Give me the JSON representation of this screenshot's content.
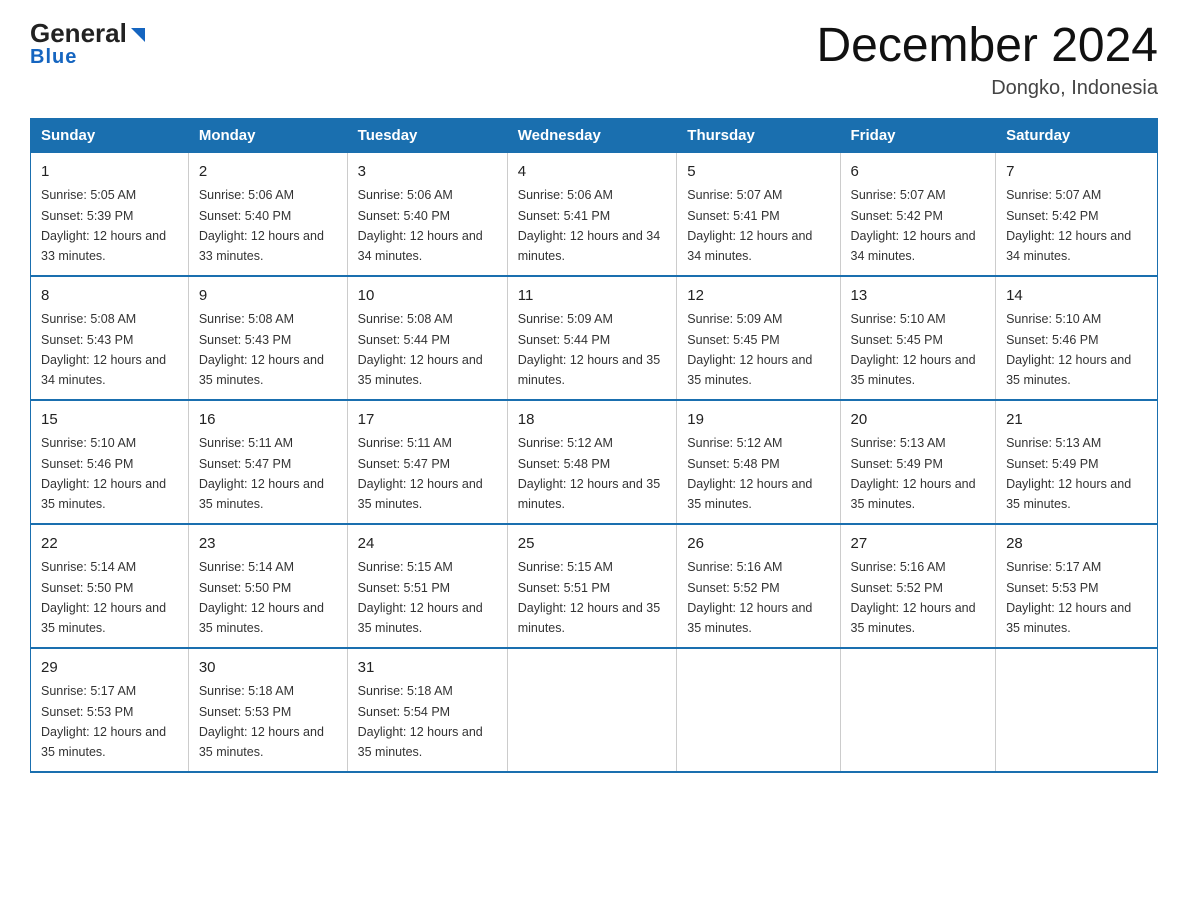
{
  "logo": {
    "general": "General",
    "blue": "Blue",
    "triangle_color": "#1565c0"
  },
  "title": {
    "month_year": "December 2024",
    "location": "Dongko, Indonesia"
  },
  "headers": [
    "Sunday",
    "Monday",
    "Tuesday",
    "Wednesday",
    "Thursday",
    "Friday",
    "Saturday"
  ],
  "weeks": [
    [
      {
        "day": "1",
        "sunrise": "5:05 AM",
        "sunset": "5:39 PM",
        "daylight": "12 hours and 33 minutes."
      },
      {
        "day": "2",
        "sunrise": "5:06 AM",
        "sunset": "5:40 PM",
        "daylight": "12 hours and 33 minutes."
      },
      {
        "day": "3",
        "sunrise": "5:06 AM",
        "sunset": "5:40 PM",
        "daylight": "12 hours and 34 minutes."
      },
      {
        "day": "4",
        "sunrise": "5:06 AM",
        "sunset": "5:41 PM",
        "daylight": "12 hours and 34 minutes."
      },
      {
        "day": "5",
        "sunrise": "5:07 AM",
        "sunset": "5:41 PM",
        "daylight": "12 hours and 34 minutes."
      },
      {
        "day": "6",
        "sunrise": "5:07 AM",
        "sunset": "5:42 PM",
        "daylight": "12 hours and 34 minutes."
      },
      {
        "day": "7",
        "sunrise": "5:07 AM",
        "sunset": "5:42 PM",
        "daylight": "12 hours and 34 minutes."
      }
    ],
    [
      {
        "day": "8",
        "sunrise": "5:08 AM",
        "sunset": "5:43 PM",
        "daylight": "12 hours and 34 minutes."
      },
      {
        "day": "9",
        "sunrise": "5:08 AM",
        "sunset": "5:43 PM",
        "daylight": "12 hours and 35 minutes."
      },
      {
        "day": "10",
        "sunrise": "5:08 AM",
        "sunset": "5:44 PM",
        "daylight": "12 hours and 35 minutes."
      },
      {
        "day": "11",
        "sunrise": "5:09 AM",
        "sunset": "5:44 PM",
        "daylight": "12 hours and 35 minutes."
      },
      {
        "day": "12",
        "sunrise": "5:09 AM",
        "sunset": "5:45 PM",
        "daylight": "12 hours and 35 minutes."
      },
      {
        "day": "13",
        "sunrise": "5:10 AM",
        "sunset": "5:45 PM",
        "daylight": "12 hours and 35 minutes."
      },
      {
        "day": "14",
        "sunrise": "5:10 AM",
        "sunset": "5:46 PM",
        "daylight": "12 hours and 35 minutes."
      }
    ],
    [
      {
        "day": "15",
        "sunrise": "5:10 AM",
        "sunset": "5:46 PM",
        "daylight": "12 hours and 35 minutes."
      },
      {
        "day": "16",
        "sunrise": "5:11 AM",
        "sunset": "5:47 PM",
        "daylight": "12 hours and 35 minutes."
      },
      {
        "day": "17",
        "sunrise": "5:11 AM",
        "sunset": "5:47 PM",
        "daylight": "12 hours and 35 minutes."
      },
      {
        "day": "18",
        "sunrise": "5:12 AM",
        "sunset": "5:48 PM",
        "daylight": "12 hours and 35 minutes."
      },
      {
        "day": "19",
        "sunrise": "5:12 AM",
        "sunset": "5:48 PM",
        "daylight": "12 hours and 35 minutes."
      },
      {
        "day": "20",
        "sunrise": "5:13 AM",
        "sunset": "5:49 PM",
        "daylight": "12 hours and 35 minutes."
      },
      {
        "day": "21",
        "sunrise": "5:13 AM",
        "sunset": "5:49 PM",
        "daylight": "12 hours and 35 minutes."
      }
    ],
    [
      {
        "day": "22",
        "sunrise": "5:14 AM",
        "sunset": "5:50 PM",
        "daylight": "12 hours and 35 minutes."
      },
      {
        "day": "23",
        "sunrise": "5:14 AM",
        "sunset": "5:50 PM",
        "daylight": "12 hours and 35 minutes."
      },
      {
        "day": "24",
        "sunrise": "5:15 AM",
        "sunset": "5:51 PM",
        "daylight": "12 hours and 35 minutes."
      },
      {
        "day": "25",
        "sunrise": "5:15 AM",
        "sunset": "5:51 PM",
        "daylight": "12 hours and 35 minutes."
      },
      {
        "day": "26",
        "sunrise": "5:16 AM",
        "sunset": "5:52 PM",
        "daylight": "12 hours and 35 minutes."
      },
      {
        "day": "27",
        "sunrise": "5:16 AM",
        "sunset": "5:52 PM",
        "daylight": "12 hours and 35 minutes."
      },
      {
        "day": "28",
        "sunrise": "5:17 AM",
        "sunset": "5:53 PM",
        "daylight": "12 hours and 35 minutes."
      }
    ],
    [
      {
        "day": "29",
        "sunrise": "5:17 AM",
        "sunset": "5:53 PM",
        "daylight": "12 hours and 35 minutes."
      },
      {
        "day": "30",
        "sunrise": "5:18 AM",
        "sunset": "5:53 PM",
        "daylight": "12 hours and 35 minutes."
      },
      {
        "day": "31",
        "sunrise": "5:18 AM",
        "sunset": "5:54 PM",
        "daylight": "12 hours and 35 minutes."
      },
      null,
      null,
      null,
      null
    ]
  ]
}
